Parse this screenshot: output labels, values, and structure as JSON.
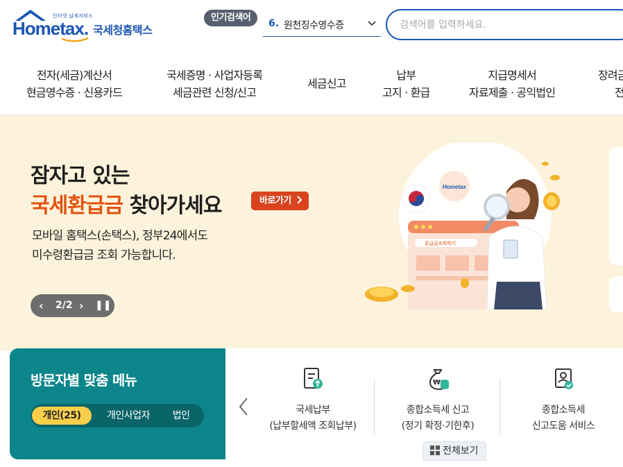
{
  "logo": {
    "sub": "인터넷 납세서비스",
    "brand": "Hometax.",
    "name": "국세청홈택스"
  },
  "popular": {
    "badge": "인기검색어",
    "rank": "6.",
    "term": "원천징수영수증"
  },
  "search": {
    "placeholder": "검색어를 입력하세요."
  },
  "nav": {
    "items": [
      {
        "line1": "전자(세금)계산서",
        "line2": "현금영수증 · 신용카드"
      },
      {
        "line1": "국세증명 · 사업자등록",
        "line2": "세금관련 신청/신고"
      },
      {
        "line1": "세금신고",
        "line2": ""
      },
      {
        "line1": "납부",
        "line2": "고지 · 환급"
      },
      {
        "line1": "지급명세서",
        "line2": "자료제출 · 공익법인"
      },
      {
        "line1": "장려금",
        "line2": "전"
      }
    ]
  },
  "banner": {
    "line1": "잠자고 있는",
    "highlight": "국세환급금",
    "line2_rest": " 찾아가세요",
    "button": "바로가기",
    "desc1": "모바일 홈택스(손택스), 정부24에서도",
    "desc2": "미수령환급금 조회 가능합니다.",
    "pager": "2/2",
    "illus_search_label": "환급금조회하기",
    "illus_badge": "Hometax"
  },
  "visitor": {
    "title": "방문자별 맞춤 메뉴",
    "tabs": [
      "개인(25)",
      "개인사업자",
      "법인"
    ]
  },
  "services": {
    "items": [
      {
        "title": "국세납부",
        "sub": "(납부할세액 조회납부)"
      },
      {
        "title": "종합소득세 신고",
        "sub": "(정기 확정·기한후)"
      },
      {
        "title": "종합소득세",
        "sub": "신고도움 서비스"
      }
    ],
    "view_all": "전체보기"
  },
  "colors": {
    "brand_blue": "#1a56b4",
    "banner_bg": "#fdf3dc",
    "highlight_orange": "#e2520f",
    "teal": "#0c868b",
    "tab_yellow": "#f8cf4a"
  }
}
